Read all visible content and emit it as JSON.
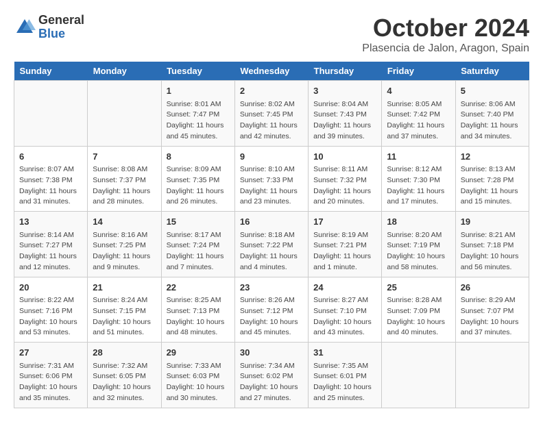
{
  "header": {
    "logo_general": "General",
    "logo_blue": "Blue",
    "month_title": "October 2024",
    "location": "Plasencia de Jalon, Aragon, Spain"
  },
  "days_of_week": [
    "Sunday",
    "Monday",
    "Tuesday",
    "Wednesday",
    "Thursday",
    "Friday",
    "Saturday"
  ],
  "weeks": [
    [
      {
        "day": "",
        "content": ""
      },
      {
        "day": "",
        "content": ""
      },
      {
        "day": "1",
        "content": "Sunrise: 8:01 AM\nSunset: 7:47 PM\nDaylight: 11 hours and 45 minutes."
      },
      {
        "day": "2",
        "content": "Sunrise: 8:02 AM\nSunset: 7:45 PM\nDaylight: 11 hours and 42 minutes."
      },
      {
        "day": "3",
        "content": "Sunrise: 8:04 AM\nSunset: 7:43 PM\nDaylight: 11 hours and 39 minutes."
      },
      {
        "day": "4",
        "content": "Sunrise: 8:05 AM\nSunset: 7:42 PM\nDaylight: 11 hours and 37 minutes."
      },
      {
        "day": "5",
        "content": "Sunrise: 8:06 AM\nSunset: 7:40 PM\nDaylight: 11 hours and 34 minutes."
      }
    ],
    [
      {
        "day": "6",
        "content": "Sunrise: 8:07 AM\nSunset: 7:38 PM\nDaylight: 11 hours and 31 minutes."
      },
      {
        "day": "7",
        "content": "Sunrise: 8:08 AM\nSunset: 7:37 PM\nDaylight: 11 hours and 28 minutes."
      },
      {
        "day": "8",
        "content": "Sunrise: 8:09 AM\nSunset: 7:35 PM\nDaylight: 11 hours and 26 minutes."
      },
      {
        "day": "9",
        "content": "Sunrise: 8:10 AM\nSunset: 7:33 PM\nDaylight: 11 hours and 23 minutes."
      },
      {
        "day": "10",
        "content": "Sunrise: 8:11 AM\nSunset: 7:32 PM\nDaylight: 11 hours and 20 minutes."
      },
      {
        "day": "11",
        "content": "Sunrise: 8:12 AM\nSunset: 7:30 PM\nDaylight: 11 hours and 17 minutes."
      },
      {
        "day": "12",
        "content": "Sunrise: 8:13 AM\nSunset: 7:28 PM\nDaylight: 11 hours and 15 minutes."
      }
    ],
    [
      {
        "day": "13",
        "content": "Sunrise: 8:14 AM\nSunset: 7:27 PM\nDaylight: 11 hours and 12 minutes."
      },
      {
        "day": "14",
        "content": "Sunrise: 8:16 AM\nSunset: 7:25 PM\nDaylight: 11 hours and 9 minutes."
      },
      {
        "day": "15",
        "content": "Sunrise: 8:17 AM\nSunset: 7:24 PM\nDaylight: 11 hours and 7 minutes."
      },
      {
        "day": "16",
        "content": "Sunrise: 8:18 AM\nSunset: 7:22 PM\nDaylight: 11 hours and 4 minutes."
      },
      {
        "day": "17",
        "content": "Sunrise: 8:19 AM\nSunset: 7:21 PM\nDaylight: 11 hours and 1 minute."
      },
      {
        "day": "18",
        "content": "Sunrise: 8:20 AM\nSunset: 7:19 PM\nDaylight: 10 hours and 58 minutes."
      },
      {
        "day": "19",
        "content": "Sunrise: 8:21 AM\nSunset: 7:18 PM\nDaylight: 10 hours and 56 minutes."
      }
    ],
    [
      {
        "day": "20",
        "content": "Sunrise: 8:22 AM\nSunset: 7:16 PM\nDaylight: 10 hours and 53 minutes."
      },
      {
        "day": "21",
        "content": "Sunrise: 8:24 AM\nSunset: 7:15 PM\nDaylight: 10 hours and 51 minutes."
      },
      {
        "day": "22",
        "content": "Sunrise: 8:25 AM\nSunset: 7:13 PM\nDaylight: 10 hours and 48 minutes."
      },
      {
        "day": "23",
        "content": "Sunrise: 8:26 AM\nSunset: 7:12 PM\nDaylight: 10 hours and 45 minutes."
      },
      {
        "day": "24",
        "content": "Sunrise: 8:27 AM\nSunset: 7:10 PM\nDaylight: 10 hours and 43 minutes."
      },
      {
        "day": "25",
        "content": "Sunrise: 8:28 AM\nSunset: 7:09 PM\nDaylight: 10 hours and 40 minutes."
      },
      {
        "day": "26",
        "content": "Sunrise: 8:29 AM\nSunset: 7:07 PM\nDaylight: 10 hours and 37 minutes."
      }
    ],
    [
      {
        "day": "27",
        "content": "Sunrise: 7:31 AM\nSunset: 6:06 PM\nDaylight: 10 hours and 35 minutes."
      },
      {
        "day": "28",
        "content": "Sunrise: 7:32 AM\nSunset: 6:05 PM\nDaylight: 10 hours and 32 minutes."
      },
      {
        "day": "29",
        "content": "Sunrise: 7:33 AM\nSunset: 6:03 PM\nDaylight: 10 hours and 30 minutes."
      },
      {
        "day": "30",
        "content": "Sunrise: 7:34 AM\nSunset: 6:02 PM\nDaylight: 10 hours and 27 minutes."
      },
      {
        "day": "31",
        "content": "Sunrise: 7:35 AM\nSunset: 6:01 PM\nDaylight: 10 hours and 25 minutes."
      },
      {
        "day": "",
        "content": ""
      },
      {
        "day": "",
        "content": ""
      }
    ]
  ]
}
